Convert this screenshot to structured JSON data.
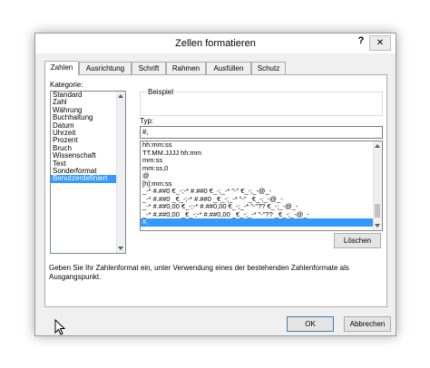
{
  "dialog": {
    "title": "Zellen formatieren",
    "help_label": "?",
    "close_label": "✕"
  },
  "tabs": [
    "Zahlen",
    "Ausrichtung",
    "Schrift",
    "Rahmen",
    "Ausfüllen",
    "Schutz"
  ],
  "category": {
    "label": "Kategorie:",
    "items": [
      "Standard",
      "Zahl",
      "Währung",
      "Buchhaltung",
      "Datum",
      "Uhrzeit",
      "Prozent",
      "Bruch",
      "Wissenschaft",
      "Text",
      "Sonderformat",
      "Benutzerdefiniert"
    ],
    "selected": "Benutzerdefiniert"
  },
  "sample": {
    "label": "Beispiel"
  },
  "type": {
    "label": "Typ:",
    "value": "#,",
    "formats": [
      "hh:mm:ss",
      "TT.MM.JJJJ hh:mm",
      "mm:ss",
      "mm:ss,0",
      "@",
      "[h]:mm:ss",
      "_-* #.##0 €_-;-* #.##0 €_-;_-* \"-\" €_-;_-@_-",
      "_-* #.##0 _€_-;-* #.##0 _€_-;_-* \"-\" _€_-;_-@_-",
      "_-* #.##0,00 €_-;-* #.##0,00 €_-;_-* \"-\"?? €_-;_-@_-",
      "_-* #.##0,00 _€_-;-* #.##0,00 _€_-;_-* \"-\"?? _€_-;_-@_-",
      "#,"
    ],
    "selected": "#,"
  },
  "buttons": {
    "delete": "Löschen",
    "ok": "OK",
    "cancel": "Abbrechen"
  },
  "description": "Geben Sie Ihr Zahlenformat ein, unter Verwendung eines der bestehenden Zahlenformate als Ausgangspunkt."
}
